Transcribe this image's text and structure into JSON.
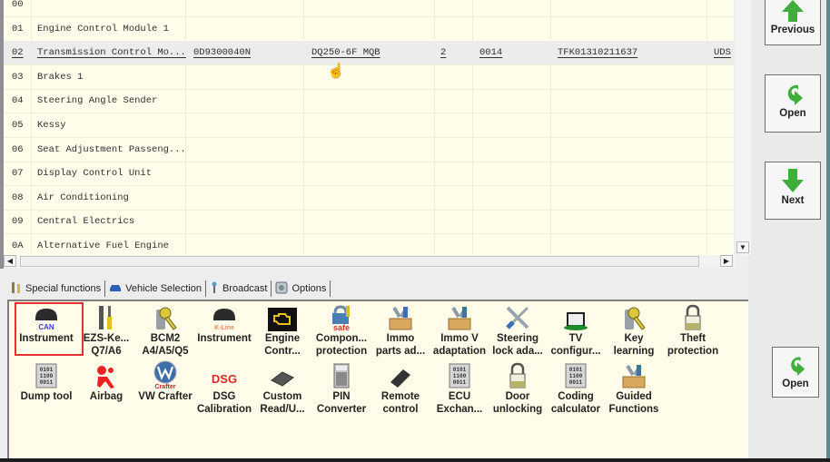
{
  "module_list": {
    "rows": [
      {
        "addr": "00",
        "name": "",
        "part": "",
        "component": "",
        "index": "",
        "sw": "",
        "serial": "",
        "proto": ""
      },
      {
        "addr": "01",
        "name": "Engine Control Module 1",
        "part": "",
        "component": "",
        "index": "",
        "sw": "",
        "serial": "",
        "proto": ""
      },
      {
        "addr": "02",
        "name": "Transmission Control Mo...",
        "part": "0D9300040N",
        "component": "DQ250-6F MQB",
        "index": "2",
        "sw": "0014",
        "serial": "TFK01310211637",
        "proto": "UDS"
      },
      {
        "addr": "03",
        "name": "Brakes 1",
        "part": "",
        "component": "",
        "index": "",
        "sw": "",
        "serial": "",
        "proto": ""
      },
      {
        "addr": "04",
        "name": "Steering Angle Sender",
        "part": "",
        "component": "",
        "index": "",
        "sw": "",
        "serial": "",
        "proto": ""
      },
      {
        "addr": "05",
        "name": "Kessy",
        "part": "",
        "component": "",
        "index": "",
        "sw": "",
        "serial": "",
        "proto": ""
      },
      {
        "addr": "06",
        "name": "Seat Adjustment Passeng...",
        "part": "",
        "component": "",
        "index": "",
        "sw": "",
        "serial": "",
        "proto": ""
      },
      {
        "addr": "07",
        "name": "Display Control Unit",
        "part": "",
        "component": "",
        "index": "",
        "sw": "",
        "serial": "",
        "proto": ""
      },
      {
        "addr": "08",
        "name": "Air Conditioning",
        "part": "",
        "component": "",
        "index": "",
        "sw": "",
        "serial": "",
        "proto": ""
      },
      {
        "addr": "09",
        "name": "Central Electrics",
        "part": "",
        "component": "",
        "index": "",
        "sw": "",
        "serial": "",
        "proto": ""
      },
      {
        "addr": "0A",
        "name": "Alternative Fuel Engine",
        "part": "",
        "component": "",
        "index": "",
        "sw": "",
        "serial": "",
        "proto": ""
      }
    ],
    "selected_addr": "02"
  },
  "nav": {
    "previous_label": "Previous",
    "open_label": "Open",
    "next_label": "Next",
    "open_bottom_label": "Open"
  },
  "tabs": [
    {
      "label": "Special functions",
      "icon": "tools-icon",
      "active": true
    },
    {
      "label": "Vehicle Selection",
      "icon": "car-icon",
      "active": false
    },
    {
      "label": "Broadcast",
      "icon": "antenna-icon",
      "active": false
    },
    {
      "label": "Options",
      "icon": "options-icon",
      "active": false
    }
  ],
  "functions": [
    {
      "l1": "Instrument",
      "l2": "",
      "icon": "instrument-can-icon",
      "selected": true
    },
    {
      "l1": "EZS-Ke...",
      "l2": "Q7/A6",
      "icon": "screwdriver-wrench-icon"
    },
    {
      "l1": "BCM2",
      "l2": "A4/A5/Q5",
      "icon": "key-icon"
    },
    {
      "l1": "Instrument",
      "l2": "",
      "icon": "instrument-kline-icon"
    },
    {
      "l1": "Engine",
      "l2": "Contr...",
      "icon": "engine-icon"
    },
    {
      "l1": "Compon...",
      "l2": "protection",
      "icon": "safe-lock-icon"
    },
    {
      "l1": "Immo",
      "l2": "parts ad...",
      "icon": "toolbox-icon"
    },
    {
      "l1": "Immo V",
      "l2": "adaptation",
      "icon": "toolbox-icon"
    },
    {
      "l1": "Steering",
      "l2": "lock ada...",
      "icon": "crossed-tools-icon"
    },
    {
      "l1": "TV",
      "l2": "configur...",
      "icon": "tv-icon"
    },
    {
      "l1": "Key",
      "l2": "learning",
      "icon": "key-icon"
    },
    {
      "l1": "Theft",
      "l2": "protection",
      "icon": "padlock-icon"
    },
    {
      "l1": "Dump tool",
      "l2": "",
      "icon": "binary-doc-icon"
    },
    {
      "l1": "Airbag",
      "l2": "",
      "icon": "airbag-icon"
    },
    {
      "l1": "VW Crafter",
      "l2": "",
      "icon": "vw-logo-icon"
    },
    {
      "l1": "DSG",
      "l2": "Calibration",
      "icon": "dsg-icon",
      "icon_text": "DSG"
    },
    {
      "l1": "Custom",
      "l2": "Read/U...",
      "icon": "chip-icon"
    },
    {
      "l1": "PIN",
      "l2": "Converter",
      "icon": "calculator-icon"
    },
    {
      "l1": "Remote",
      "l2": "control",
      "icon": "remote-chip-icon"
    },
    {
      "l1": "ECU",
      "l2": "Exchan...",
      "icon": "binary-doc-icon"
    },
    {
      "l1": "Door",
      "l2": "unlocking",
      "icon": "padlock-icon"
    },
    {
      "l1": "Coding",
      "l2": "calculator",
      "icon": "binary-doc-icon"
    },
    {
      "l1": "Guided",
      "l2": "Functions",
      "icon": "toolbox-icon"
    }
  ],
  "icon_labels": {
    "can": "CAN",
    "kline": "K-Line",
    "safe": "safe",
    "crafter": "Crafter"
  },
  "colors": {
    "list_bg": "#fffeea",
    "selection_highlight": "#e83030",
    "arrow_green": "#3fae3a"
  }
}
